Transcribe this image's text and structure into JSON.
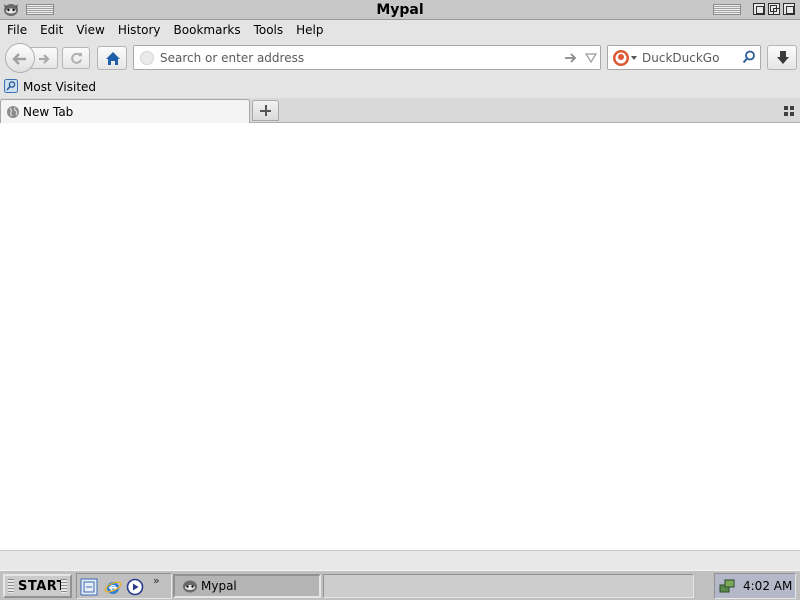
{
  "window": {
    "title": "Mypal"
  },
  "menubar": {
    "items": [
      {
        "label": "File"
      },
      {
        "label": "Edit"
      },
      {
        "label": "View"
      },
      {
        "label": "History"
      },
      {
        "label": "Bookmarks"
      },
      {
        "label": "Tools"
      },
      {
        "label": "Help"
      }
    ]
  },
  "toolbar": {
    "back_icon": "back-arrow-icon",
    "forward_icon": "forward-arrow-icon",
    "reload_icon": "reload-icon",
    "home_icon": "home-icon",
    "download_icon": "download-arrow-icon"
  },
  "urlbar": {
    "placeholder": "Search or enter address",
    "value": ""
  },
  "searchbar": {
    "placeholder": "DuckDuckGo",
    "engine_icon": "duckduckgo-icon",
    "value": ""
  },
  "bookmarks": {
    "items": [
      {
        "label": "Most Visited",
        "icon": "most-visited-icon"
      }
    ]
  },
  "tabs": {
    "items": [
      {
        "label": "New Tab",
        "icon": "globe-icon",
        "selected": true
      }
    ]
  },
  "taskbar": {
    "start_label": "START",
    "quicklaunch": [
      {
        "icon": "desktop-icon"
      },
      {
        "icon": "internet-explorer-icon"
      },
      {
        "icon": "media-player-icon"
      }
    ],
    "tasks": [
      {
        "label": "Mypal",
        "icon": "mypal-icon",
        "active": true
      }
    ],
    "clock": "4:02 AM"
  },
  "colors": {
    "window_chrome": "#e4e4e4",
    "content_background": "#ffffff",
    "taskbar": "#c0c0c0",
    "tray": "#b5b8c8",
    "home_icon": "#1f5fa8"
  }
}
